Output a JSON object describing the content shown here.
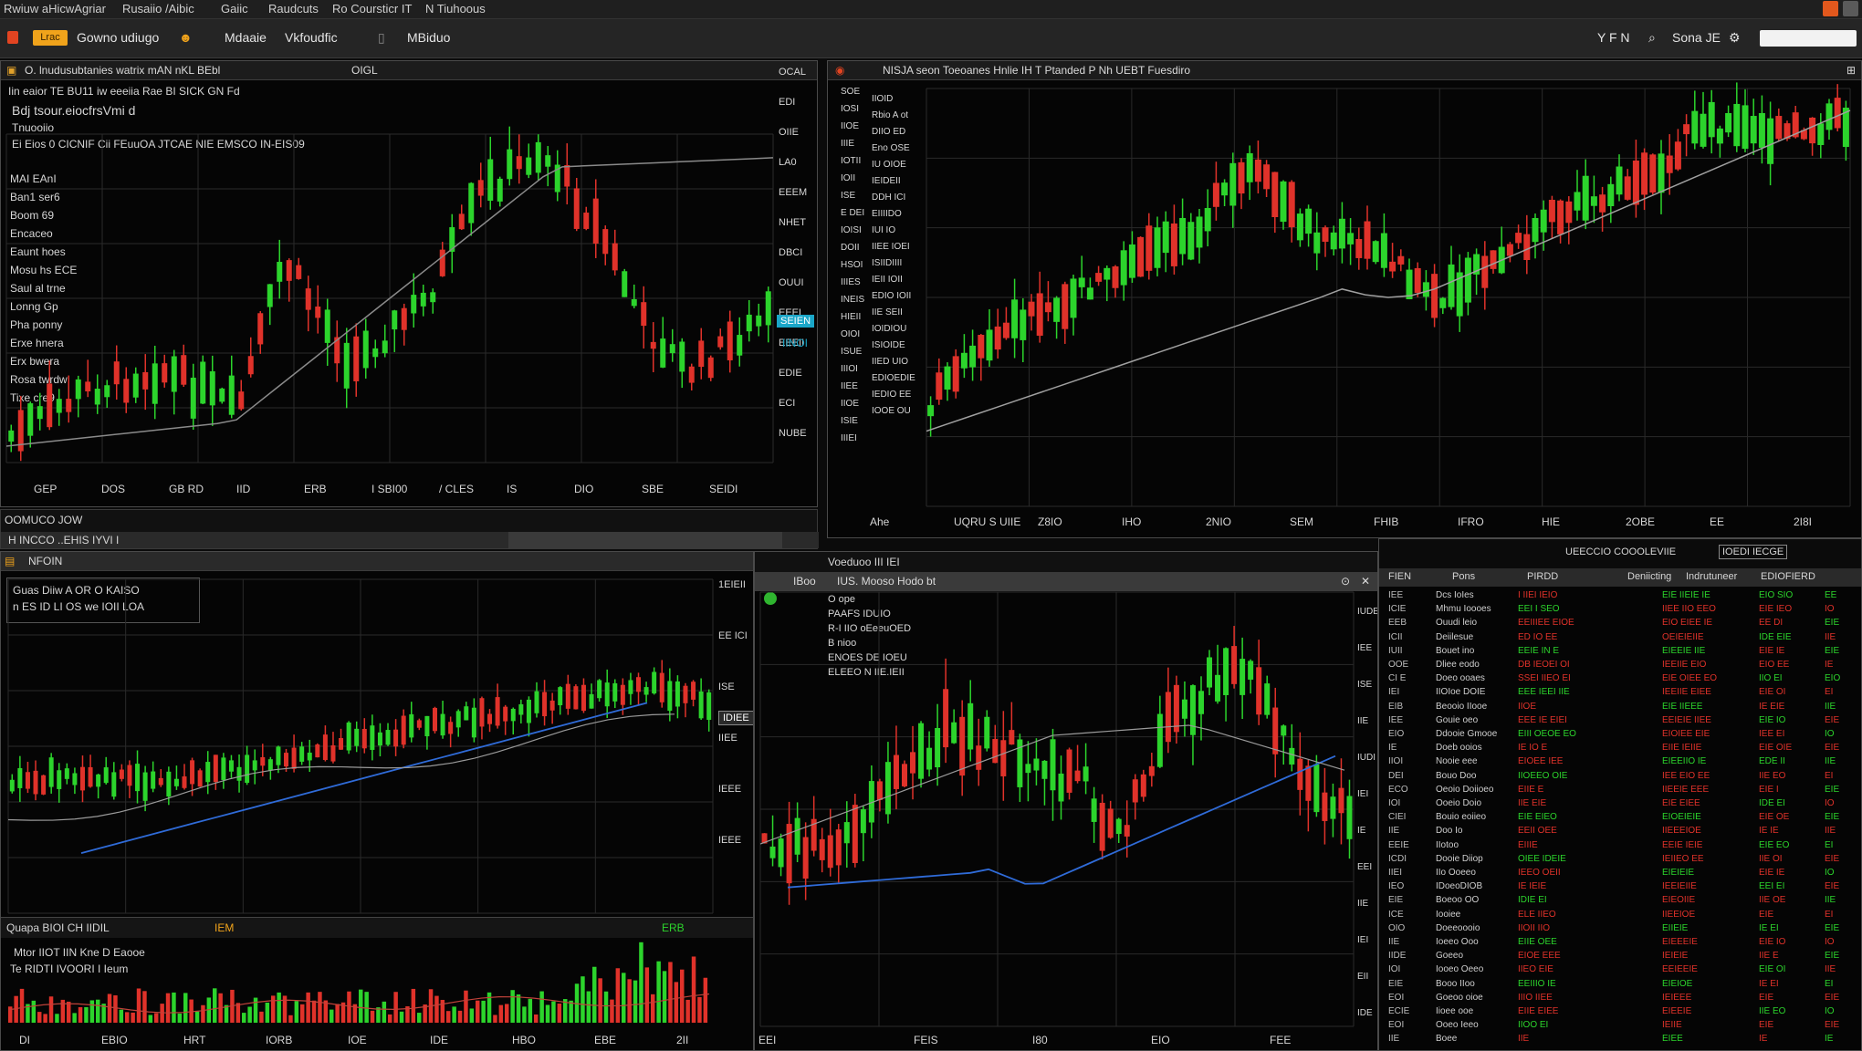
{
  "menubar": {
    "items": [
      "Rwiuw aHicwAgriar",
      "Rusaiio /Aibic",
      "Gaiic",
      "Raudcuts",
      "Ro Coursticr IT",
      "N Tiuhoous"
    ]
  },
  "toolbar": {
    "orange_label": "Lrac",
    "brand": "Gowno udiugo",
    "item1": "Mdaaie",
    "item2": "Vkfoudfic",
    "item3": "MBiduo",
    "right1": "Y F N",
    "right2": "Sona JE"
  },
  "panel1": {
    "title": "O. lnudusubtanies watrix mAN nKL BEbl",
    "title2": "OIGL",
    "info": [
      "Iin eaior TE BU11 iw eeeiia Rae BI SICK GN Fd",
      "Bdj tsour.eiocfrsVmi d",
      "Tnuooiio",
      "Ei Eios 0 CICNIF  Cii FEuuOA JTCAE NIE EMSCO IN-EIS09"
    ],
    "left_labels": [
      "MAI EAnI",
      "Ban1 ser6",
      "Boom 69",
      "Encaceo",
      "Eaunt hoes",
      "Mosu hs ECE",
      "Saul al trne",
      "Lonng Gp",
      "Pha ponny",
      "Erxe hnera",
      "Erx bwera",
      "Rosa twrdw",
      "Tixe cre9"
    ],
    "right_labels": [
      "OCAL",
      "EDI",
      "OIIE",
      "LA0",
      "EEEM",
      "NHET",
      "DBCI",
      "OUUI",
      "EEEL",
      "EEEII",
      "EDIE",
      "ECI",
      "NUBE"
    ],
    "price_tag": "SEIEN",
    "price_tag2": "IINOI",
    "x_labels": [
      "GEP",
      "DOS",
      "GB RD",
      "IID",
      "ERB",
      "I SBI00",
      "/ CLES",
      "IS",
      "DIO",
      "SBE",
      "SEIDI"
    ]
  },
  "panel1_footer": {
    "status": "OOMUCO  JOW",
    "subhead": "H INCCO ..EHIS IYVI I"
  },
  "panel2": {
    "title": "NISJA seon Toeoanes Hnlie IH T  Ptanded P Nh UEBT Fuesdiro",
    "left_col1": [
      "SOE",
      "IOSI",
      "IIOE",
      "IIIE",
      "IOTII",
      "IOII",
      "ISE",
      "E DEI",
      "IOISI",
      "DOII",
      "HSOI",
      "IIIES",
      "INEIS",
      "HIEII",
      "OIOI",
      "ISUE",
      "IIIOI",
      "IIEE",
      "IIOE",
      "ISIE",
      "IIIEI"
    ],
    "left_col2": [
      "IIOID",
      "Rbio A ot",
      "DIIO ED",
      "Eno OSE",
      "IU OIOE",
      "IEIDEII",
      "DDH ICI",
      "EIIIIDO",
      "IUI IO",
      "IIEE IOEI",
      "ISIIDIIII",
      "IEII IOII",
      "EDIO IOII",
      "IIE SEII",
      "IOIDIOU",
      "ISIOIDE",
      "IIED UIO",
      "EDIOEDIE",
      "IEDIO EE",
      "IOOE OU"
    ],
    "x_labels": [
      "Ahe",
      "UQRU S UIIE",
      "Z8IO",
      "IHO",
      "2NIO",
      "SEM",
      "FHIB",
      "IFRO",
      "HIE",
      "2OBE",
      "EE",
      "2I8I"
    ]
  },
  "panel3": {
    "title": "NFOIN",
    "info1": "Guas Diiw A OR O KAISO",
    "info2": "n ES ID LI OS we IOII LOA",
    "right_labels": [
      "1EIEII",
      "EE ICI",
      "ISE",
      "IIEE",
      "IEEE",
      "IEEE"
    ],
    "price_tag": "IDIEE",
    "vol_head": "Quapa BIOI CH IIDIL",
    "vol_head_right": "IEM",
    "vol_head_right2": "ERB",
    "vol_info1": "Mtor IIOT IIN Kne D Eaooe",
    "vol_info2": "Te RIDTI IVOORI  I Ieum",
    "x_labels": [
      "DI",
      "EBIO",
      "HRT",
      "IORB",
      "IOE",
      "IDE",
      "HBO",
      "EBE",
      "2II"
    ]
  },
  "panel4": {
    "title": "IUS.    Mooso Hodo bt",
    "title_left": "IBoo",
    "top_strip": "Voeduoo  III  IEI",
    "info": [
      "O ope",
      "PAAFS IDUIO",
      "R-I  IIO oEeeuOED",
      "B nioo",
      "ENOES DE IOEU",
      "ELEEO N IIE.IEII"
    ],
    "right_labels": [
      "IUDE",
      "IEE",
      "ISE",
      "IIE",
      "IUDI",
      "IEI",
      "IE",
      "EEI",
      "IIE",
      "IEI",
      "EII",
      "IDE"
    ],
    "x_labels": [
      "EEI",
      "FEIS",
      "I80",
      "EIO",
      "FEE"
    ]
  },
  "watchlist": {
    "title": "UEECCIO  COOOLEVIIE",
    "title_right": "IOEDI IECGE",
    "headers": [
      "FIEN",
      "Pons",
      "PIRDD",
      "Deniicting",
      "Indrutuneer",
      "EDIOFIERD"
    ],
    "rows_left": [
      "IEE",
      "ICIE",
      "EEB",
      "ICII",
      "IUII",
      "OOE",
      "CI E",
      "IEI",
      "EIB",
      "IEE",
      "EIO",
      "IE",
      "IIOI",
      "DEI",
      "ECO",
      "IOI",
      "CIEI",
      "IIE",
      "EEIE",
      "ICDI",
      "IIEI",
      "IEO",
      "EIE",
      "ICE",
      "OIO",
      "IIE",
      "IIDE",
      "IOI",
      "EIE",
      "EOI",
      "ECIE",
      "EOI",
      "IIE"
    ],
    "names": [
      "Dcs IoIes",
      "Mhmu Ioooes",
      "Ouudi leio",
      "Deiilesue",
      "Bouet ino",
      "Dliee eodo",
      "Doeo ooaes",
      "IIOIoe DOIE",
      "Beooio IIooe",
      "Gouie oeo",
      "Ddooie Gmooe",
      "Doeb ooios",
      "Nooie eee",
      "Bouo Doo",
      "Oeoio Doiioeo",
      "Ooeio Doio",
      "Bouio eoiieo",
      "Doo Io",
      "IIotoo",
      "Dooie Diiop",
      "IIo Ooeeo",
      "IDoeoDIOB",
      "Boeoo OO",
      "Iooiee",
      "Doeeoooio",
      "Ioeeo Ooo",
      "Goeeo",
      "Iooeo Oeeo",
      "Booo IIoo",
      "Goeoo oioe",
      "Iioee ooe",
      "Ooeo Ieeo",
      "Boee"
    ],
    "prices": [
      "I IIEI IEIO",
      "EEI I SEO",
      "EEIIIEE EIOE",
      "ED IO EE",
      "EEIE IN E",
      "DB IEOEI OI",
      "SSEI IIEO EI",
      "EEE IEEI IIE",
      "IIOE",
      "EEE IE EIEI",
      "EIII OEOE EO",
      "IE IO E",
      "EIOEE IEE",
      "IIOEEO OIE",
      "EIIE E",
      "IIE EIE",
      "EIE EIEO",
      "EEII OEE",
      "EIIIE",
      "OIEE IDEIE",
      "IEEO OEII",
      "IE IEIE",
      "IDIE EI",
      "ELE IIEO",
      "IIOII IIO",
      "EIIE OEE",
      "EIOE EEE",
      "IIEO EIE",
      "EEIIIO IE",
      "IIIO IIEE",
      "EIIE EIEE",
      "IIOO EI",
      "IIE"
    ],
    "changes": [
      "EIE IIEIE IE",
      "IIEE IIO EEO",
      "EIO EIEE IE",
      "OEIEIEIIE",
      "EIEEIE IIE",
      "IEEIIE EIO",
      "EIE OIEE EO",
      "IEEIIE EIEE",
      "EIE IIEEE",
      "EEIEIE IIEE",
      "EIOIEE EIE",
      "EIIE IEIIE",
      "EIEEIIO IE",
      "IEE EIO EE",
      "IIEEIE EEE",
      "EIE EIEE",
      "EIOEIEIE",
      "IIEEEIOE",
      "EEIE IEIE",
      "IEIIEO EE",
      "EIEIEIE",
      "IEEIEIIE",
      "EIEOIIE",
      "IIEEIOE",
      "EIIEIE",
      "EIEEEIE",
      "IEIEIE",
      "EEIEEIE",
      "EIEIOE",
      "IEIEEE",
      "EIEEIE",
      "IEIIE",
      "EIEE"
    ],
    "last1": [
      "EIO SIO",
      "EIE IEO",
      "EE DI",
      "IDE EIE",
      "EIE IE",
      "EIO EE",
      "IIO EI",
      "EIE OI",
      "IE EIE",
      "EIE IO",
      "IEE EI",
      "EIE OIE",
      "EDE II",
      "IIE EO",
      "EIE I",
      "IDE EI",
      "EIE OE",
      "IE IE",
      "EIE EO",
      "IIE OI",
      "EIE IE",
      "EEI EI",
      "IIE OE",
      "EIE",
      "IE EI",
      "EIE IO",
      "IIE E",
      "EIE OI",
      "IE EI",
      "EIE",
      "IIE EO",
      "EIE",
      "IE"
    ],
    "last2": [
      "EE",
      "IO",
      "EIE",
      "IIE",
      "EIE",
      "IE",
      "EIO",
      "EI",
      "IIE",
      "EIE",
      "IO",
      "EIE",
      "IIE",
      "EI",
      "EIE",
      "IO",
      "EIE",
      "IIE",
      "EI",
      "EIE",
      "IO",
      "EIE",
      "IIE",
      "EI",
      "EIE",
      "IO",
      "EIE",
      "IIE",
      "EI",
      "EIE",
      "IO",
      "EIE",
      "IE"
    ]
  },
  "colors": {
    "up": "#2cd42c",
    "down": "#e0322a",
    "bg": "#050505",
    "accent_orange": "#f0a31b",
    "cyan": "#1aa6c8"
  }
}
